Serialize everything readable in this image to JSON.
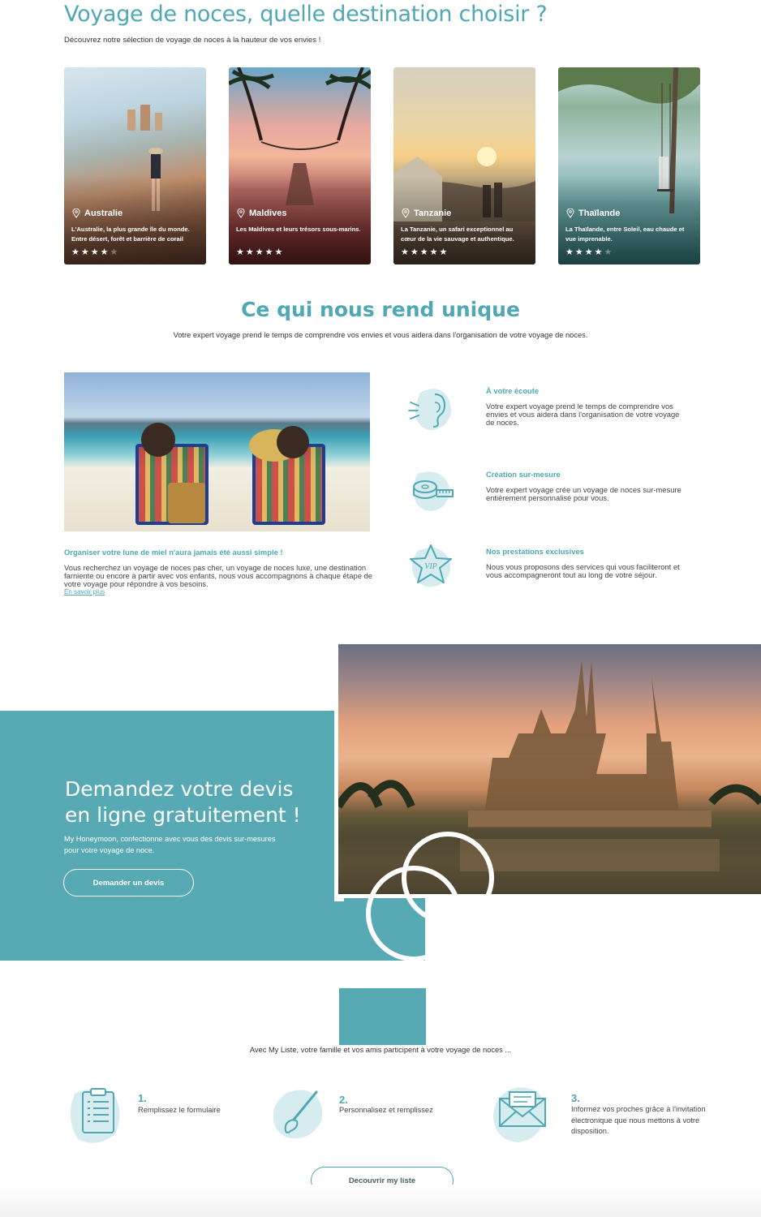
{
  "destinations": {
    "title": "Voyage de noces, quelle destination choisir ?",
    "subtitle": "Découvrez notre sélection de voyage de noces à la hauteur de vos envies !",
    "cards": [
      {
        "name": "Australie",
        "description": "L'Australie, la plus grande île du monde. Entre désert, forêt et barrière de corail",
        "rating": 4,
        "rating_max": 5
      },
      {
        "name": "Maldives",
        "description": "Les Maldives et leurs trésors sous-marins.",
        "rating": 5,
        "rating_max": 5
      },
      {
        "name": "Tanzanie",
        "description": "La Tanzanie, un safari exceptionnel au cœur de la vie sauvage et authentique.",
        "rating": 5,
        "rating_max": 5
      },
      {
        "name": "Thaïlande",
        "description": "La Thaïlande, entre Soleil, eau chaude et vue imprenable.",
        "rating": 4,
        "rating_max": 5
      }
    ]
  },
  "unique": {
    "title": "Ce qui nous rend unique",
    "subtitle": "Votre expert voyage prend le temps de comprendre vos envies et vous aidera dans l'organisation de votre voyage de noces.",
    "intro_heading": "Organiser votre lune de miel n'aura jamais été aussi simple !",
    "intro_text": "Vous recherchez un voyage de noces pas cher, un voyage de noces luxe, une destination farniente ou encore à partir avec vos enfants, nous vous accompagnons à chaque étape de votre voyage pour répondre à vos besoins.",
    "intro_link": "En savoir plus",
    "features": [
      {
        "title": "À votre écoute",
        "text": "Votre expert voyage prend le temps de comprendre vos envies et vous aidera dans l'organisation de votre voyage de noces.",
        "icon": "ear-icon"
      },
      {
        "title": "Création sur-mesure",
        "text": "Votre expert voyage crée un voyage de noces sur-mesure entièrement personnalisé pour vous.",
        "icon": "tape-measure-icon"
      },
      {
        "title": "Nos prestations exclusives",
        "text": "Nous vous proposons des services qui vous faciliteront et vous accompagneront tout au long de votre séjour.",
        "icon": "vip-star-icon"
      }
    ]
  },
  "devis": {
    "title_line1": "Demandez votre devis",
    "title_line2": "en ligne gratuitement !",
    "subtitle": "My Honeymoon, confectionne avec vous des devis sur-mesures pour votre voyage de noce.",
    "button": "Demander un devis"
  },
  "liste": {
    "subtitle": "Avec My Liste, votre famille et vos amis participent à votre voyage de noces ...",
    "steps": [
      {
        "number": "1.",
        "text": "Remplissez le formulaire",
        "icon": "clipboard-icon"
      },
      {
        "number": "2.",
        "text": "Personnalisez et remplissez",
        "icon": "brush-icon"
      },
      {
        "number": "3.",
        "text": "Informez vos proches grâce à l'invitation électronique que nous mettons à votre disposition.",
        "icon": "envelope-icon"
      }
    ],
    "button": "Decouvrir my liste"
  },
  "colors": {
    "accent": "#4fa8b4",
    "block": "#57a9b4"
  }
}
